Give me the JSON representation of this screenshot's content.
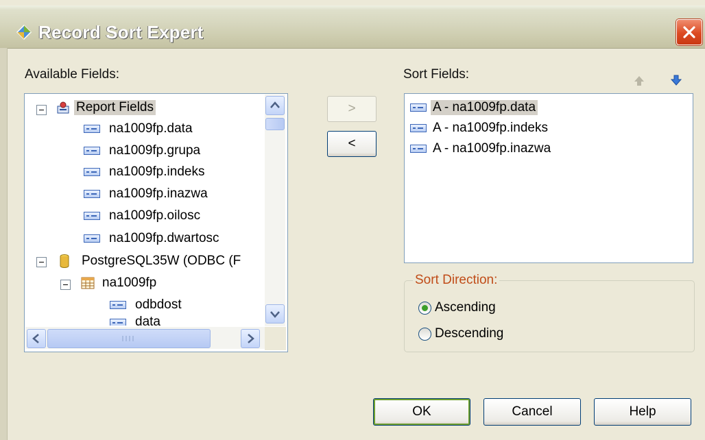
{
  "window": {
    "title": "Record Sort Expert"
  },
  "available": {
    "label": "Available Fields:",
    "root_label": "Report Fields",
    "report_fields": [
      "na1009fp.data",
      "na1009fp.grupa",
      "na1009fp.indeks",
      "na1009fp.inazwa",
      "na1009fp.oilosc",
      "na1009fp.dwartosc"
    ],
    "datasource_label": "PostgreSQL35W (ODBC (F",
    "table_label": "na1009fp",
    "table_fields": [
      "odbdost",
      "data"
    ]
  },
  "buttons": {
    "add": ">",
    "remove": "<",
    "ok": "OK",
    "cancel": "Cancel",
    "help": "Help"
  },
  "sort_fields": {
    "label": "Sort Fields:",
    "items": [
      "A - na1009fp.data",
      "A - na1009fp.indeks",
      "A - na1009fp.inazwa"
    ]
  },
  "direction": {
    "title": "Sort Direction:",
    "ascending": "Ascending",
    "descending": "Descending",
    "selected": "Ascending"
  },
  "colors": {
    "titlebar_text": "#ffffff",
    "close_red": "#dc4a22",
    "group_title": "#c04c18",
    "radio_dot": "#3c9e2a"
  }
}
